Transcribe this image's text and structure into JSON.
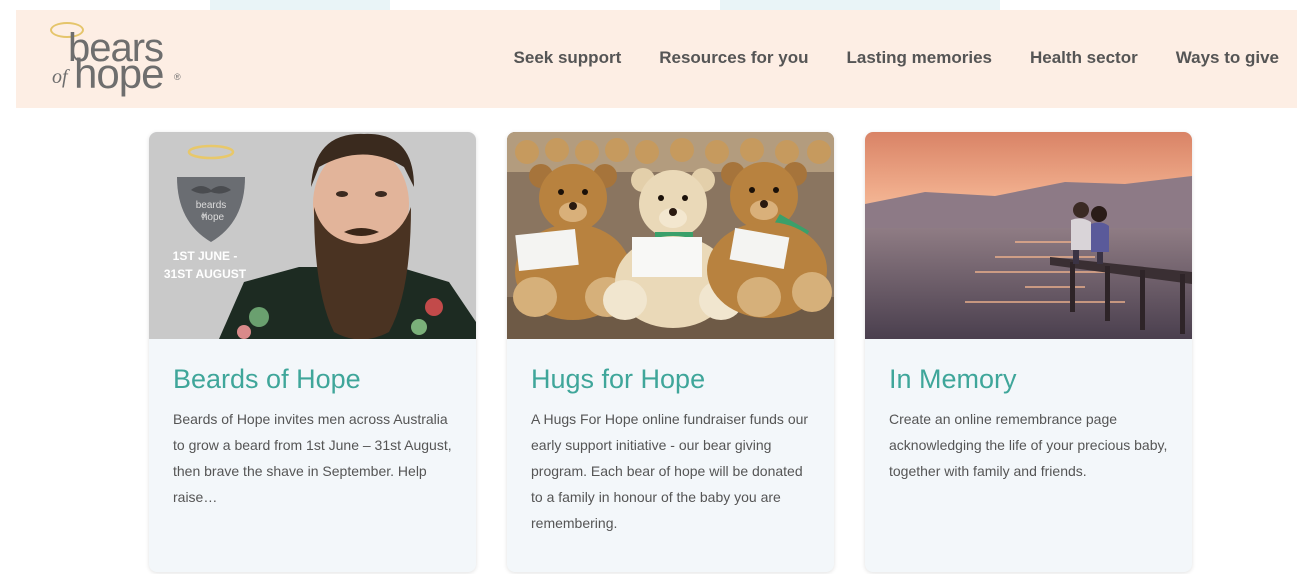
{
  "logo": {
    "line1": "bears",
    "of": "of",
    "line2": "hope",
    "reg": "®"
  },
  "nav": {
    "items": [
      "Seek support",
      "Resources for you",
      "Lasting memories",
      "Health sector",
      "Ways to give"
    ]
  },
  "cards": [
    {
      "title": "Beards of Hope",
      "body": "Beards of Hope invites men across Australia to grow a beard from 1st June – 31st August, then brave the shave in September. Help raise…",
      "badge_line1": "beards",
      "badge_line2": "of",
      "badge_line3": "hope",
      "date_line1": "1ST JUNE -",
      "date_line2": "31ST AUGUST"
    },
    {
      "title": "Hugs for Hope",
      "body": "A Hugs For Hope online fundraiser funds our early support initiative - our bear giving program. Each bear of hope will be donated to a family in honour of the baby you are remembering."
    },
    {
      "title": "In Memory",
      "body": "Create an online remembrance page acknowledging the life of your precious baby, together with family and friends."
    }
  ],
  "colors": {
    "accent": "#3fa69a",
    "header_bg": "#fdeee4",
    "card_bg": "#f3f7fa"
  }
}
